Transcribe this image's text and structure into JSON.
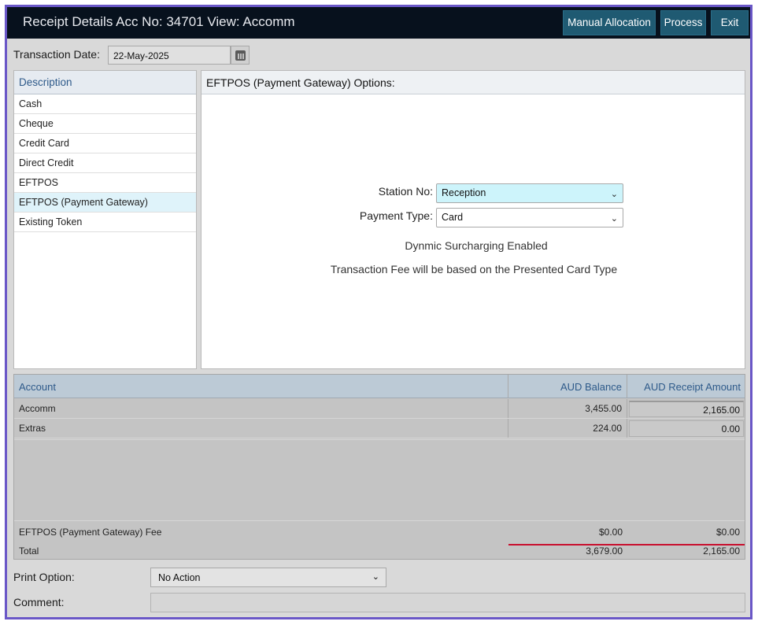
{
  "window": {
    "title": "Receipt Details Acc No: 34701 View: Accomm",
    "buttons": {
      "manual_allocation": "Manual Allocation",
      "process": "Process",
      "exit": "Exit"
    },
    "accent_color": "#6a57c7"
  },
  "transaction": {
    "label": "Transaction Date:",
    "date": "22-May-2025",
    "calendar_icon": "calendar-icon"
  },
  "description": {
    "header": "Description",
    "items": [
      {
        "label": "Cash"
      },
      {
        "label": "Cheque"
      },
      {
        "label": "Credit Card"
      },
      {
        "label": "Direct Credit"
      },
      {
        "label": "EFTPOS"
      },
      {
        "label": "EFTPOS (Payment Gateway)",
        "selected": true
      },
      {
        "label": "Existing Token"
      }
    ]
  },
  "options": {
    "header": "EFTPOS (Payment Gateway) Options:",
    "station_label": "Station No:",
    "station_value": "Reception",
    "payment_type_label": "Payment Type:",
    "payment_type_value": "Card",
    "note_surcharge": "Dynmic Surcharging Enabled",
    "note_fee": "Transaction Fee will be based on the Presented Card Type"
  },
  "accounts": {
    "headers": {
      "account": "Account",
      "balance": "AUD Balance",
      "amount": "AUD Receipt Amount"
    },
    "rows": [
      {
        "account": "Accomm",
        "balance": "3,455.00",
        "amount": "2,165.00"
      },
      {
        "account": "Extras",
        "balance": "224.00",
        "amount": "0.00"
      }
    ],
    "fee": {
      "label": "EFTPOS (Payment Gateway) Fee",
      "balance": "$0.00",
      "amount": "$0.00"
    },
    "total": {
      "label": "Total",
      "balance": "3,679.00",
      "amount": "2,165.00"
    }
  },
  "print_option": {
    "label": "Print Option:",
    "value": "No Action"
  },
  "comment": {
    "label": "Comment:",
    "value": ""
  }
}
